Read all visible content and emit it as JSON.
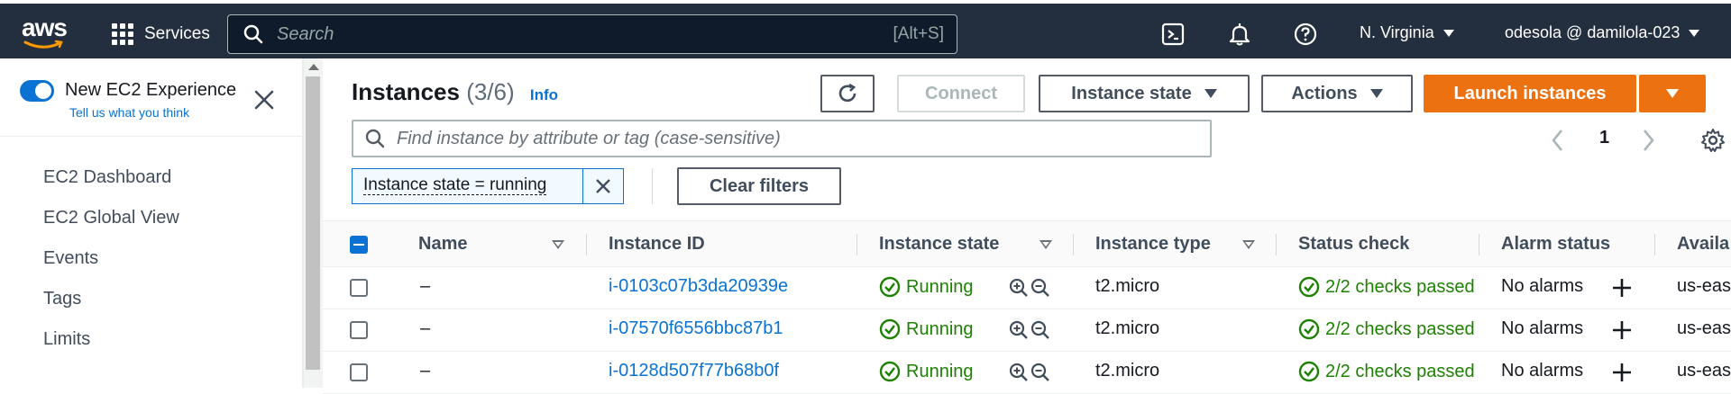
{
  "topbar": {
    "logo_text": "aws",
    "services_label": "Services",
    "search_placeholder": "Search",
    "search_shortcut": "[Alt+S]",
    "region": "N. Virginia",
    "account": "odesola @ damilola-023",
    "icons": [
      "cloudshell-icon",
      "bell-icon",
      "help-icon"
    ]
  },
  "sidebar": {
    "toggle_label": "New EC2 Experience",
    "toggle_link": "Tell us what you think",
    "toggle_on": true,
    "items": [
      {
        "label": "EC2 Dashboard"
      },
      {
        "label": "EC2 Global View"
      },
      {
        "label": "Events"
      },
      {
        "label": "Tags"
      },
      {
        "label": "Limits"
      }
    ]
  },
  "main": {
    "title": "Instances",
    "count": "(3/6)",
    "info_link": "Info",
    "buttons": {
      "connect": "Connect",
      "instance_state": "Instance state",
      "actions": "Actions",
      "launch": "Launch instances"
    },
    "search_placeholder": "Find instance by attribute or tag (case-sensitive)",
    "page_number": "1",
    "filter_token": "Instance state = running",
    "clear_filters": "Clear filters",
    "columns": [
      "Name",
      "Instance ID",
      "Instance state",
      "Instance type",
      "Status check",
      "Alarm status",
      "Availa"
    ],
    "rows": [
      {
        "name": "–",
        "id": "i-0103c07b3da20939e",
        "state": "Running",
        "type": "t2.micro",
        "check": "2/2 checks passed",
        "alarm": "No alarms",
        "az": "us-eas"
      },
      {
        "name": "–",
        "id": "i-07570f6556bbc87b1",
        "state": "Running",
        "type": "t2.micro",
        "check": "2/2 checks passed",
        "alarm": "No alarms",
        "az": "us-eas"
      },
      {
        "name": "–",
        "id": "i-0128d507f77b68b0f",
        "state": "Running",
        "type": "t2.micro",
        "check": "2/2 checks passed",
        "alarm": "No alarms",
        "az": "us-eas"
      }
    ]
  },
  "colors": {
    "topbar_bg": "#232f3e",
    "primary": "#ec7211",
    "link": "#0972d3",
    "success": "#1d8102"
  }
}
